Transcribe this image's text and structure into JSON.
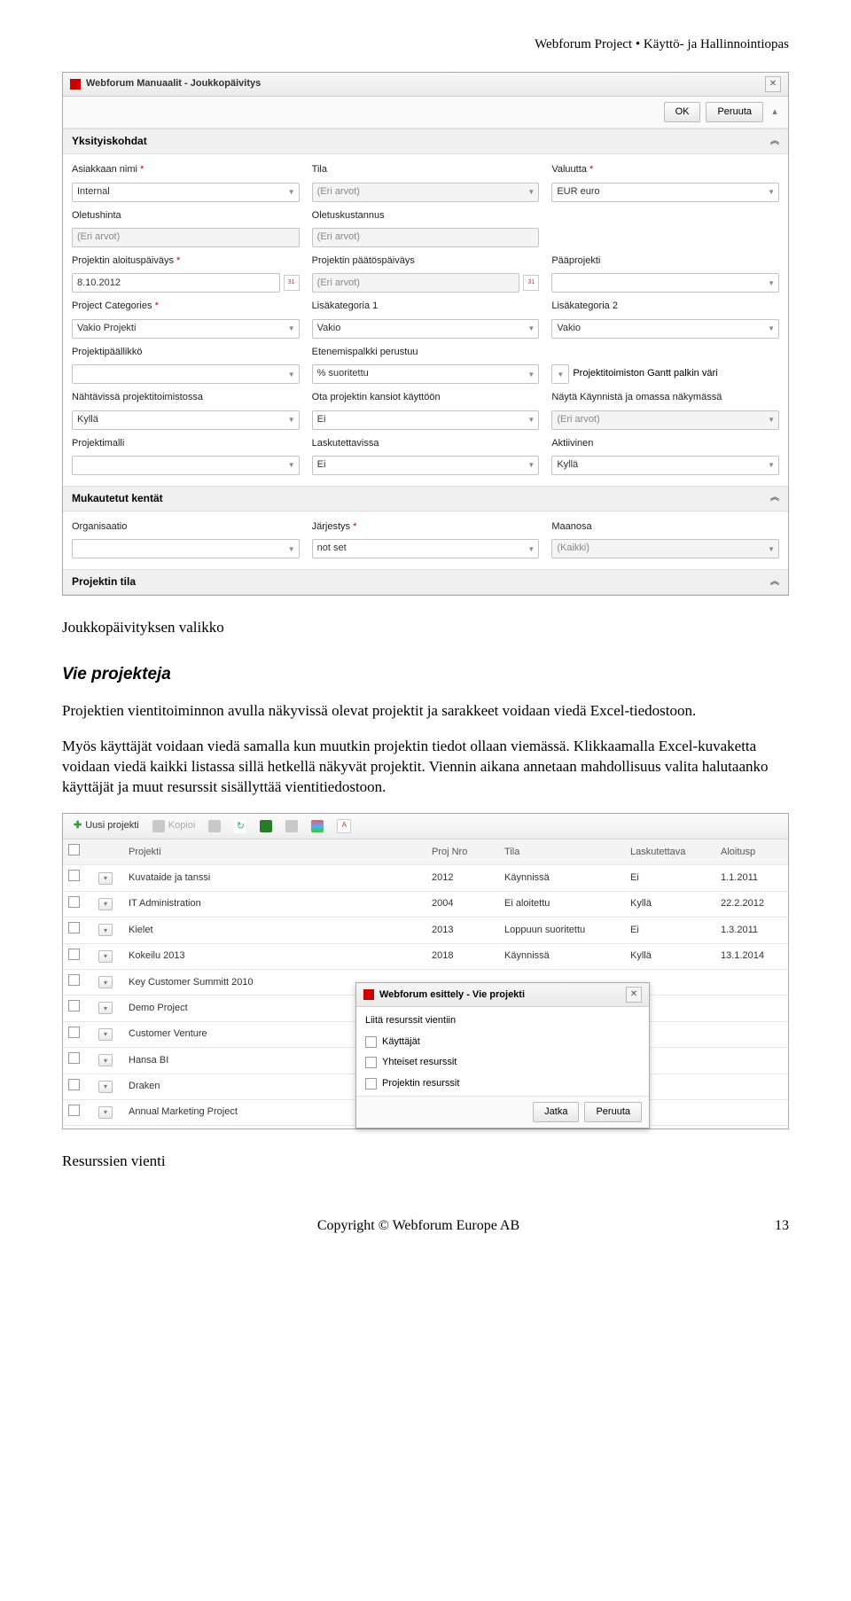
{
  "doc_header": "Webforum Project • Käyttö- ja Hallinnointiopas",
  "shot1": {
    "title": "Webforum Manuaalit - Joukkopäivitys",
    "ok": "OK",
    "cancel": "Peruuta",
    "section_details": "Yksityiskohdat",
    "section_custom": "Mukautetut kentät",
    "section_status": "Projektin tila",
    "fields": {
      "cust_name_label": "Asiakkaan nimi",
      "cust_name_value": "Internal",
      "tila_label": "Tila",
      "tila_value": "(Eri arvot)",
      "valuutta_label": "Valuutta",
      "valuutta_value": "EUR euro",
      "oletushinta_label": "Oletushinta",
      "oletushinta_value": "(Eri arvot)",
      "oletuskust_label": "Oletuskustannus",
      "oletuskust_value": "(Eri arvot)",
      "start_label": "Projektin aloituspäiväys",
      "start_value": "8.10.2012",
      "end_label": "Projektin päätöspäiväys",
      "end_value": "(Eri arvot)",
      "paaprj_label": "Pääprojekti",
      "cats_label": "Project Categories",
      "cats_value": "Vakio Projekti",
      "lisakat1_label": "Lisäkategoria 1",
      "lisakat1_value": "Vakio",
      "lisakat2_label": "Lisäkategoria 2",
      "lisakat2_value": "Vakio",
      "ppaallikko_label": "Projektipäällikkö",
      "epalkki_label": "Etenemispalkki perustuu",
      "epalkki_value": "% suoritettu",
      "gantt_label": "Projektitoimiston Gantt palkin väri",
      "nahtavissa_label": "Nähtävissä projektitoimistossa",
      "nahtavissa_value": "Kyllä",
      "otakansiot_label": "Ota projektin kansiot käyttöön",
      "otakansiot_value": "Ei",
      "naytakaynnista_label": "Näytä Käynnistä ja omassa näkymässä",
      "naytakaynnista_value": "(Eri arvot)",
      "projektimalli_label": "Projektimalli",
      "laskutettavissa_label": "Laskutettavissa",
      "laskutettavissa_value": "Ei",
      "aktiivinen_label": "Aktiivinen",
      "aktiivinen_value": "Kyllä",
      "org_label": "Organisaatio",
      "jarjestys_label": "Järjestys",
      "jarjestys_value": "not set",
      "maanosa_label": "Maanosa",
      "maanosa_value": "(Kaikki)"
    }
  },
  "caption1": "Joukkopäivityksen valikko",
  "heading_vie": "Vie projekteja",
  "para1": "Projektien vientitoiminnon avulla näkyvissä olevat projektit ja sarakkeet voidaan viedä Excel-tiedostoon.",
  "para2": "Myös käyttäjät voidaan viedä samalla kun muutkin projektin tiedot ollaan viemässä. Klikkaamalla Excel-kuvaketta voidaan viedä kaikki listassa sillä hetkellä näkyvät projektit. Viennin aikana annetaan mahdollisuus valita halutaanko käyttäjät ja muut resurssit sisällyttää vientitiedostoon.",
  "shot2": {
    "new_project": "Uusi projekti",
    "copy": "Kopioi",
    "cols": {
      "proj": "Projekti",
      "num": "Proj Nro",
      "tila": "Tila",
      "lask": "Laskutettava",
      "aloit": "Aloitusp"
    },
    "rows": [
      {
        "name": "Kuvataide ja tanssi",
        "num": "2012",
        "tila": "Käynnissä",
        "lask": "Ei",
        "aloit": "1.1.2011"
      },
      {
        "name": "IT Administration",
        "num": "2004",
        "tila": "Ei aloitettu",
        "lask": "Kyllä",
        "aloit": "22.2.2012"
      },
      {
        "name": "Kielet",
        "num": "2013",
        "tila": "Loppuun suoritettu",
        "lask": "Ei",
        "aloit": "1.3.2011"
      },
      {
        "name": "Kokeilu 2013",
        "num": "2018",
        "tila": "Käynnissä",
        "lask": "Kyllä",
        "aloit": "13.1.2014"
      },
      {
        "name": "Key Customer Summitt 2010",
        "num": "",
        "tila": "",
        "lask": "",
        "aloit": ""
      },
      {
        "name": "Demo Project",
        "num": "",
        "tila": "",
        "lask": "",
        "aloit": ""
      },
      {
        "name": "Customer Venture",
        "num": "",
        "tila": "",
        "lask": "",
        "aloit": ""
      },
      {
        "name": "Hansa BI",
        "num": "",
        "tila": "",
        "lask": "",
        "aloit": ""
      },
      {
        "name": "Draken",
        "num": "",
        "tila": "",
        "lask": "",
        "aloit": ""
      },
      {
        "name": "Annual Marketing Project",
        "num": "",
        "tila": "",
        "lask": "",
        "aloit": ""
      }
    ],
    "popup": {
      "title": "Webforum esittely - Vie projekti",
      "line_top": "Liitä resurssit vientiin",
      "opt1": "Käyttäjät",
      "opt2": "Yhteiset resurssit",
      "opt3": "Projektin resurssit",
      "ok": "Jatka",
      "cancel": "Peruuta"
    }
  },
  "caption2": "Resurssien vienti",
  "footer_center": "Copyright © Webforum Europe AB",
  "footer_page": "13"
}
